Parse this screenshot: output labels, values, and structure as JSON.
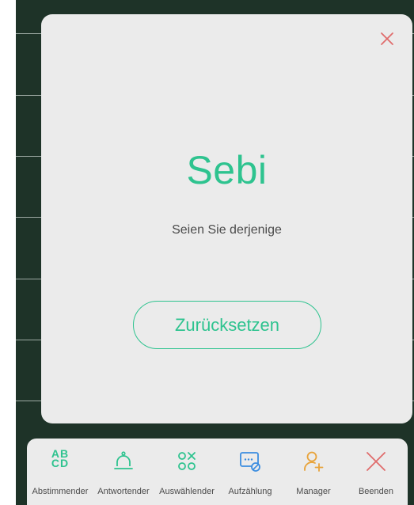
{
  "dialog": {
    "name": "Sebi",
    "subtitle": "Seien Sie derjenige",
    "reset_label": "Zurücksetzen"
  },
  "toolbar": {
    "items": [
      {
        "label": "Abstimmender",
        "icon": "abcd-icon",
        "glyph_top": "AB",
        "glyph_bottom": "CD"
      },
      {
        "label": "Antwortender",
        "icon": "bell-icon"
      },
      {
        "label": "Auswählender",
        "icon": "shapes-icon"
      },
      {
        "label": "Aufzählung",
        "icon": "list-edit-icon"
      },
      {
        "label": "Manager",
        "icon": "add-user-icon"
      },
      {
        "label": "Beenden",
        "icon": "close-icon"
      }
    ]
  },
  "colors": {
    "accent": "#2ec38f",
    "manager": "#e8a33a",
    "danger": "#e06c6c",
    "board": "#1e3328",
    "panel": "#ebebeb",
    "icon_blue": "#3b8de0"
  }
}
